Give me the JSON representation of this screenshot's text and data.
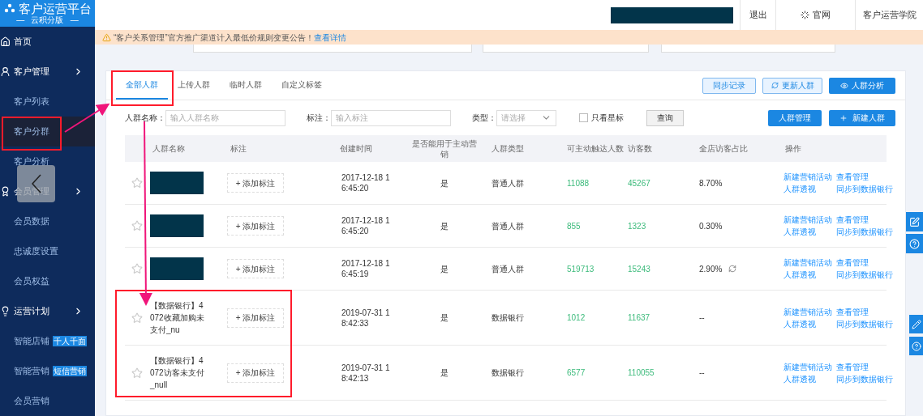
{
  "sidebar": {
    "logo": {
      "title": "客户运营平台",
      "subtitle": "—   云积分版   —"
    },
    "items": [
      {
        "label": "首页",
        "kind": "section",
        "selected": false
      },
      {
        "label": "客户管理",
        "kind": "group",
        "selected": false
      },
      {
        "label": "客户列表",
        "kind": "sub",
        "selected": false
      },
      {
        "label": "客户分群",
        "kind": "sub",
        "selected": true
      },
      {
        "label": "客户分析",
        "kind": "sub",
        "selected": false
      },
      {
        "label": "会员管理",
        "kind": "group",
        "selected": false
      },
      {
        "label": "会员数据",
        "kind": "sub",
        "selected": false
      },
      {
        "label": "忠诚度设置",
        "kind": "sub",
        "selected": false
      },
      {
        "label": "会员权益",
        "kind": "sub",
        "selected": false
      },
      {
        "label": "运营计划",
        "kind": "group",
        "selected": false
      },
      {
        "label": "智能店铺",
        "kind": "sub",
        "badge": "千人千面",
        "selected": false
      },
      {
        "label": "智能营销",
        "kind": "sub",
        "badge": "短信营销",
        "selected": false
      },
      {
        "label": "会员营销",
        "kind": "sub",
        "selected": false
      }
    ]
  },
  "topbar": {
    "links": [
      {
        "label": "退出",
        "kind": "plain"
      },
      {
        "label": "官网",
        "kind": "logo"
      },
      {
        "label": "客户运营学院",
        "kind": "plain"
      }
    ]
  },
  "notice": {
    "text": "“客户关系管理”官方推广渠道计入最低价规则变更公告！",
    "link": "查看详情"
  },
  "tabs": [
    {
      "label": "全部人群",
      "selected": true
    },
    {
      "label": "上传人群",
      "selected": false
    },
    {
      "label": "临时人群",
      "selected": false
    },
    {
      "label": "自定义标签",
      "selected": false
    }
  ],
  "tab_buttons": [
    {
      "label": "同步记录",
      "kind": "light"
    },
    {
      "label": "更新人群",
      "kind": "refresh"
    },
    {
      "label": "人群分析",
      "kind": "eye"
    }
  ],
  "filters": {
    "name_label": "人群名称：",
    "name_placeholder": "输入人群名称",
    "note_label": "标注：",
    "note_placeholder": "输入标注",
    "type_label": "类型：",
    "type_placeholder": "请选择",
    "star_only": {
      "label": "只看星标",
      "checked": false
    },
    "query": "查询",
    "manage": "人群管理",
    "create": "新建人群"
  },
  "table": {
    "columns": [
      "人群名称",
      "标注",
      "创建时间",
      "是否能用于主动营销",
      "人群类型",
      "可主动触达人数",
      "访客数",
      "全店访客占比",
      "操作"
    ],
    "rows": [
      {
        "starred": false,
        "note": "+ 添加标注",
        "created": "2017-12-18 16:45:20",
        "active": "是",
        "type": "普通人群",
        "reach": "11088",
        "visitors": "45267",
        "share": "8.70%",
        "syncing": false,
        "actions": [
          "新建营销活动",
          "查看管理",
          "人群透视",
          "同步到数据银行"
        ]
      },
      {
        "starred": false,
        "note": "+ 添加标注",
        "created": "2017-12-18 16:45:20",
        "active": "是",
        "type": "普通人群",
        "reach": "855",
        "visitors": "1323",
        "share": "0.30%",
        "syncing": false,
        "actions": [
          "新建营销活动",
          "查看管理",
          "人群透视",
          "同步到数据银行"
        ]
      },
      {
        "starred": false,
        "note": "+ 添加标注",
        "created": "2017-12-18 16:45:19",
        "active": "是",
        "type": "普通人群",
        "reach": "519713",
        "visitors": "15243",
        "share": "2.90%",
        "syncing": true,
        "actions": [
          "新建营销活动",
          "查看管理",
          "人群透视",
          "同步到数据银行"
        ]
      },
      {
        "starred": false,
        "name": "【数据银行】4072收藏加购未支付_nu",
        "note": "+ 添加标注",
        "created": "2019-07-31 18:42:33",
        "active": "是",
        "type": "数据银行",
        "reach": "1012",
        "visitors": "11637",
        "share": "--",
        "syncing": false,
        "actions": [
          "新建营销活动",
          "查看管理",
          "人群透视",
          "同步到数据银行"
        ]
      },
      {
        "starred": false,
        "name": "【数据银行】4072访客未支付_null",
        "note": "+ 添加标注",
        "created": "2019-07-31 18:42:13",
        "active": "是",
        "type": "数据银行",
        "reach": "6577",
        "visitors": "110055",
        "share": "--",
        "syncing": false,
        "actions": [
          "新建营销活动",
          "查看管理",
          "人群透视",
          "同步到数据银行"
        ]
      }
    ]
  }
}
